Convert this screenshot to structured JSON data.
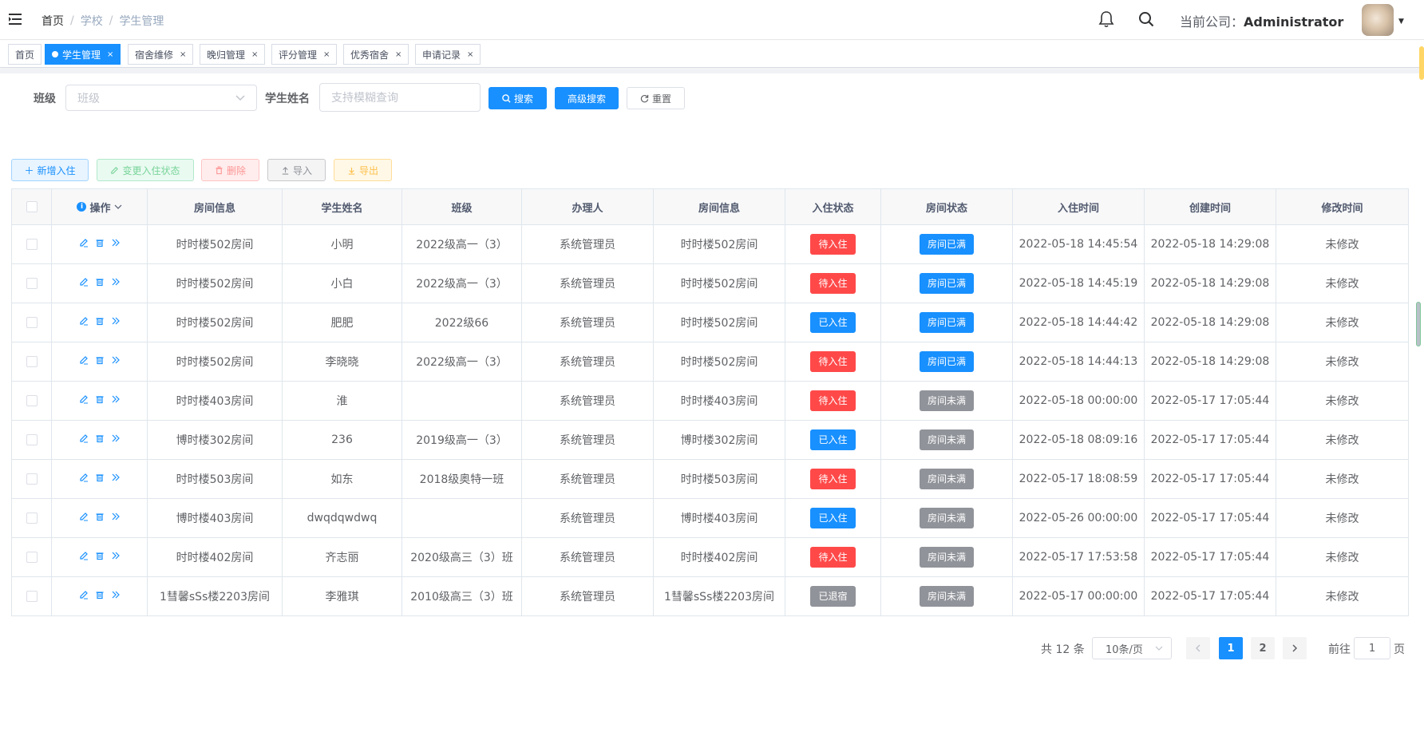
{
  "breadcrumb": [
    "首页",
    "学校",
    "学生管理"
  ],
  "header": {
    "company_label": "当前公司：",
    "company_name": "Administrator"
  },
  "tags": [
    {
      "label": "首页",
      "active": false,
      "closable": false
    },
    {
      "label": "学生管理",
      "active": true,
      "closable": true
    },
    {
      "label": "宿舍维修",
      "active": false,
      "closable": true
    },
    {
      "label": "晚归管理",
      "active": false,
      "closable": true
    },
    {
      "label": "评分管理",
      "active": false,
      "closable": true
    },
    {
      "label": "优秀宿舍",
      "active": false,
      "closable": true
    },
    {
      "label": "申请记录",
      "active": false,
      "closable": true
    }
  ],
  "search": {
    "class_label": "班级",
    "class_placeholder": "班级",
    "name_label": "学生姓名",
    "name_placeholder": "支持模糊查询",
    "search_btn": "搜索",
    "advanced_btn": "高级搜索",
    "reset_btn": "重置"
  },
  "toolbar": {
    "add": "新增入住",
    "change_status": "变更入住状态",
    "delete": "删除",
    "import": "导入",
    "export": "导出"
  },
  "table": {
    "headers": [
      "操作",
      "房间信息",
      "学生姓名",
      "班级",
      "办理人",
      "房间信息",
      "入住状态",
      "房间状态",
      "入住时间",
      "创建时间",
      "修改时间"
    ],
    "rows": [
      {
        "room": "时时楼502房间",
        "name": "小明",
        "class": "2022级高一（3）",
        "handler": "系统管理员",
        "room2": "时时楼502房间",
        "status": "待入住",
        "status_color": "#ff4949",
        "room_status": "房间已满",
        "room_status_color": "#1890ff",
        "checkin": "2022-05-18 14:45:54",
        "created": "2022-05-18 14:29:08",
        "modified": "未修改"
      },
      {
        "room": "时时楼502房间",
        "name": "小白",
        "class": "2022级高一（3）",
        "handler": "系统管理员",
        "room2": "时时楼502房间",
        "status": "待入住",
        "status_color": "#ff4949",
        "room_status": "房间已满",
        "room_status_color": "#1890ff",
        "checkin": "2022-05-18 14:45:19",
        "created": "2022-05-18 14:29:08",
        "modified": "未修改"
      },
      {
        "room": "时时楼502房间",
        "name": "肥肥",
        "class": "2022级66",
        "handler": "系统管理员",
        "room2": "时时楼502房间",
        "status": "已入住",
        "status_color": "#1890ff",
        "room_status": "房间已满",
        "room_status_color": "#1890ff",
        "checkin": "2022-05-18 14:44:42",
        "created": "2022-05-18 14:29:08",
        "modified": "未修改"
      },
      {
        "room": "时时楼502房间",
        "name": "李晓晓",
        "class": "2022级高一（3）",
        "handler": "系统管理员",
        "room2": "时时楼502房间",
        "status": "待入住",
        "status_color": "#ff4949",
        "room_status": "房间已满",
        "room_status_color": "#1890ff",
        "checkin": "2022-05-18 14:44:13",
        "created": "2022-05-18 14:29:08",
        "modified": "未修改"
      },
      {
        "room": "时时楼403房间",
        "name": "淮",
        "class": "",
        "handler": "系统管理员",
        "room2": "时时楼403房间",
        "status": "待入住",
        "status_color": "#ff4949",
        "room_status": "房间未满",
        "room_status_color": "#909399",
        "checkin": "2022-05-18 00:00:00",
        "created": "2022-05-17 17:05:44",
        "modified": "未修改"
      },
      {
        "room": "博时楼302房间",
        "name": "236",
        "class": "2019级高一（3）",
        "handler": "系统管理员",
        "room2": "博时楼302房间",
        "status": "已入住",
        "status_color": "#1890ff",
        "room_status": "房间未满",
        "room_status_color": "#909399",
        "checkin": "2022-05-18 08:09:16",
        "created": "2022-05-17 17:05:44",
        "modified": "未修改"
      },
      {
        "room": "时时楼503房间",
        "name": "如东",
        "class": "2018级奥特一班",
        "handler": "系统管理员",
        "room2": "时时楼503房间",
        "status": "待入住",
        "status_color": "#ff4949",
        "room_status": "房间未满",
        "room_status_color": "#909399",
        "checkin": "2022-05-17 18:08:59",
        "created": "2022-05-17 17:05:44",
        "modified": "未修改"
      },
      {
        "room": "博时楼403房间",
        "name": "dwqdqwdwq",
        "class": "",
        "handler": "系统管理员",
        "room2": "博时楼403房间",
        "status": "已入住",
        "status_color": "#1890ff",
        "room_status": "房间未满",
        "room_status_color": "#909399",
        "checkin": "2022-05-26 00:00:00",
        "created": "2022-05-17 17:05:44",
        "modified": "未修改"
      },
      {
        "room": "时时楼402房间",
        "name": "齐志丽",
        "class": "2020级高三（3）班",
        "handler": "系统管理员",
        "room2": "时时楼402房间",
        "status": "待入住",
        "status_color": "#ff4949",
        "room_status": "房间未满",
        "room_status_color": "#909399",
        "checkin": "2022-05-17 17:53:58",
        "created": "2022-05-17 17:05:44",
        "modified": "未修改"
      },
      {
        "room": "1彗馨sSs楼2203房间",
        "name": "李雅琪",
        "class": "2010级高三（3）班",
        "handler": "系统管理员",
        "room2": "1彗馨sSs楼2203房间",
        "status": "已退宿",
        "status_color": "#909399",
        "room_status": "房间未满",
        "room_status_color": "#909399",
        "checkin": "2022-05-17 00:00:00",
        "created": "2022-05-17 17:05:44",
        "modified": "未修改"
      }
    ]
  },
  "pagination": {
    "total_text": "共 12 条",
    "page_size": "10条/页",
    "pages": [
      "1",
      "2"
    ],
    "current": "1",
    "goto_label": "前往",
    "goto_value": "1",
    "goto_unit": "页",
    "prev_icon": "chevron-left-icon",
    "next_icon": "chevron-right-icon"
  },
  "colors": {
    "primary": "#1890ff",
    "danger": "#ff4949",
    "info": "#909399"
  }
}
